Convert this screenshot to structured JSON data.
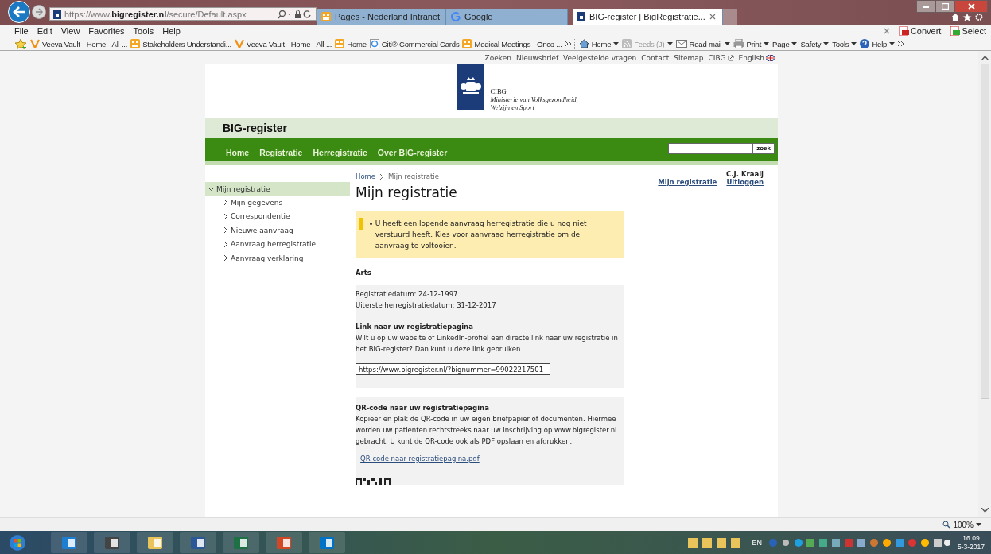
{
  "browser": {
    "address": {
      "prefix": "https://www.",
      "domain": "bigregister.nl",
      "path": "/secure/Default.aspx"
    },
    "tabs": [
      {
        "title": "Pages - Nederland Intranet",
        "kind": "pages",
        "selected": false
      },
      {
        "title": "Google",
        "kind": "google",
        "selected": false
      },
      {
        "title": "BIG-register | BigRegistratie...",
        "kind": "big",
        "selected": true
      }
    ],
    "menu": [
      "File",
      "Edit",
      "View",
      "Favorites",
      "Tools",
      "Help"
    ],
    "pdf_tools": [
      "Convert",
      "Select"
    ],
    "favorites": [
      {
        "label": "Veeva Vault - Home - All ...",
        "kind": "veeva"
      },
      {
        "label": "Stakeholders Understandi...",
        "kind": "pages"
      },
      {
        "label": "Veeva Vault - Home - All ...",
        "kind": "veeva"
      },
      {
        "label": "Home",
        "kind": "pages"
      },
      {
        "label": "Citi® Commercial Cards",
        "kind": "ie"
      },
      {
        "label": "Medical Meetings - Onco ...",
        "kind": "pages"
      }
    ],
    "command_bar": [
      {
        "label": "Home",
        "kind": "home",
        "disabled": false
      },
      {
        "label": "Feeds (J)",
        "kind": "feeds",
        "disabled": true
      },
      {
        "label": "Read mail",
        "kind": "mail",
        "disabled": false
      },
      {
        "label": "Print",
        "kind": "print",
        "disabled": false
      },
      {
        "label": "Page",
        "kind": "menu",
        "disabled": false
      },
      {
        "label": "Safety",
        "kind": "menu",
        "disabled": false
      },
      {
        "label": "Tools",
        "kind": "menu",
        "disabled": false
      },
      {
        "label": "Help",
        "kind": "help",
        "disabled": false
      }
    ],
    "zoom": "100%"
  },
  "page": {
    "top_links": [
      "Zoeken",
      "Nieuwsbrief",
      "Veelgestelde vragen",
      "Contact",
      "Sitemap",
      "CIBG",
      "English"
    ],
    "logo": {
      "org": "CIBG",
      "lines": [
        "Ministerie van Volksgezondheid,",
        "Welzijn en Sport"
      ]
    },
    "site_title": "BIG-register",
    "nav": [
      "Home",
      "Registratie",
      "Herregistratie",
      "Over BIG-register"
    ],
    "search": {
      "button": "zoek"
    },
    "sidebar": [
      {
        "label": "Mijn registratie",
        "selected": true,
        "expanded": true,
        "children": [
          {
            "label": "Mijn gegevens",
            "selected": false
          },
          {
            "label": "Correspondentie",
            "selected": false
          },
          {
            "label": "Nieuwe aanvraag",
            "selected": false
          },
          {
            "label": "Aanvraag herregistratie",
            "selected": false
          },
          {
            "label": "Aanvraag verklaring",
            "selected": false
          }
        ]
      }
    ],
    "breadcrumb": [
      "Home",
      "Mijn registratie"
    ],
    "user": {
      "name": "C.J. Kraaij",
      "links": [
        "Mijn registratie",
        "Uitloggen"
      ]
    },
    "heading": "Mijn registratie",
    "notice": "U heeft een lopende aanvraag herregistratie die u nog niet verstuurd heeft. Kies voor aanvraag herregistratie om de aanvraag te voltooien.",
    "profession": "Arts",
    "dates": [
      "Registratiedatum: 24-12-1997",
      "Uiterste herregistratiedatum: 31-12-2017"
    ],
    "link_section": {
      "title": "Link naar uw registratiepagina",
      "text": "Wilt u op uw website of LinkedIn-profiel een directe link naar uw registratie in het BIG-register? Dan kunt u deze link gebruiken.",
      "url": "https://www.bigregister.nl/?bignummer=99022217501"
    },
    "qr_section": {
      "title": "QR-code naar uw registratiepagina",
      "text": "Kopieer en plak de QR-code in uw eigen briefpapier of documenten. Hiermee worden uw patienten rechtstreeks naar uw inschrijving op www.bigregister.nl gebracht. U kunt de QR-code ook als PDF opslaan en afdrukken.",
      "link_prefix": "-",
      "link": "QR-code naar registratiepagina.pdf"
    }
  },
  "taskbar": {
    "apps": [
      {
        "kind": "ie"
      },
      {
        "kind": "network"
      },
      {
        "kind": "folder"
      },
      {
        "kind": "word"
      },
      {
        "kind": "excel"
      },
      {
        "kind": "powerpoint"
      },
      {
        "kind": "outlook"
      }
    ],
    "language": "EN",
    "time": "16:09",
    "date": "5-3-2017"
  }
}
